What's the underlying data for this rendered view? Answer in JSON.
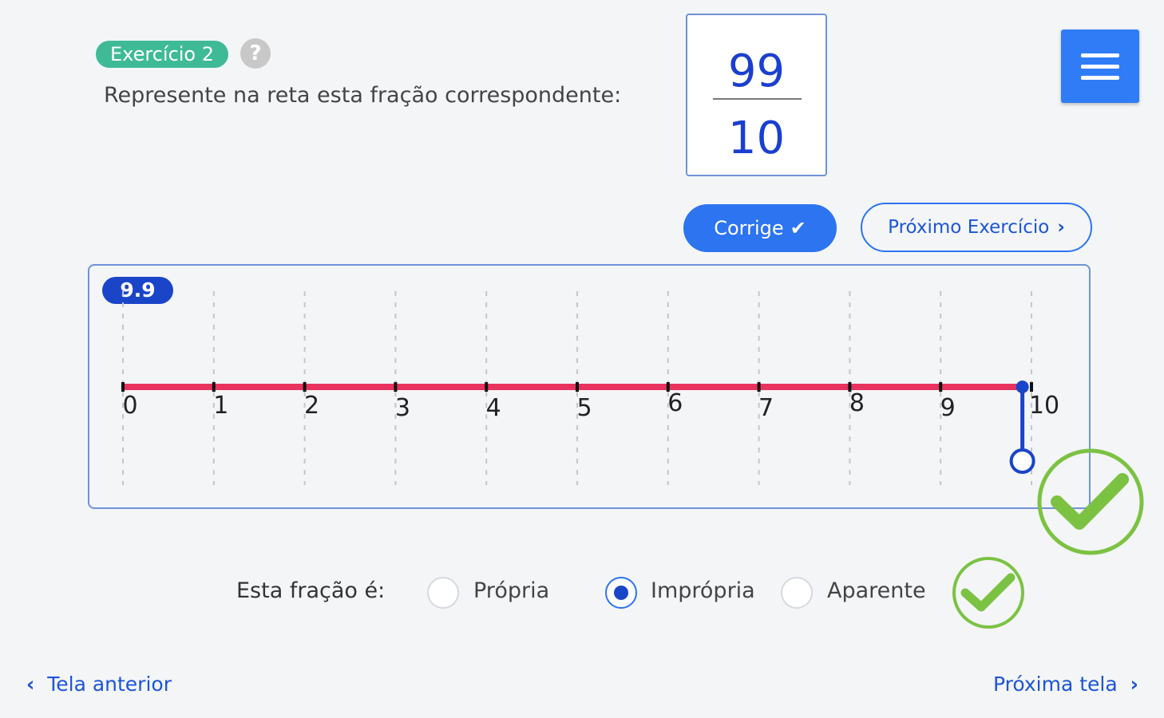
{
  "header": {
    "exercise_badge": "Exercício 2",
    "help_icon": "?",
    "instruction": "Represente na reta esta fração correspondente:"
  },
  "fraction": {
    "numerator": "99",
    "denominator": "10"
  },
  "menu": {
    "icon": "hamburger-menu-icon"
  },
  "actions": {
    "corrige_label": "Corrige",
    "corrige_icon": "check-icon",
    "next_exercise_label": "Próximo Exercício",
    "next_exercise_icon": "chevron-right-icon"
  },
  "number_line": {
    "current_value_label": "9.9",
    "ticks": [
      "0",
      "1",
      "2",
      "3",
      "4",
      "5",
      "6",
      "7",
      "8",
      "9",
      "10"
    ],
    "min": 0,
    "max": 10,
    "marker_value": 9.9,
    "line_color": "#e8335f",
    "marker_color": "#1a45c8",
    "result_icon": "green-check-circle-icon"
  },
  "classification": {
    "question": "Esta fração é:",
    "options": [
      {
        "label": "Própria",
        "selected": false
      },
      {
        "label": "Imprópria",
        "selected": true
      },
      {
        "label": "Aparente",
        "selected": false
      }
    ],
    "result_icon": "green-check-circle-icon"
  },
  "footer": {
    "prev_label": "Tela anterior",
    "next_label": "Próxima tela",
    "prev_icon": "chevron-left-icon",
    "next_icon": "chevron-right-icon"
  },
  "colors": {
    "primary_blue": "#2c74f0",
    "badge_green": "#3fba97",
    "success_green": "#7cc242"
  }
}
